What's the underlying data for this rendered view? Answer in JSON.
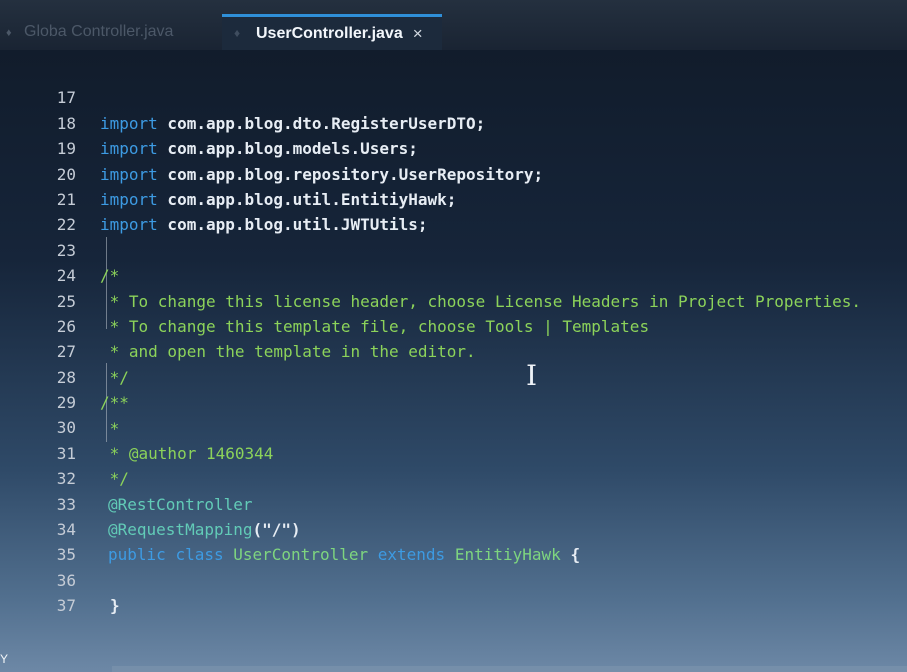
{
  "tabs": {
    "inactive_label": "Globa Controller.java",
    "active_label": "UserController.java",
    "close_glyph": "×"
  },
  "editor": {
    "lines": [
      {
        "num": "17",
        "kw": "import",
        "text": " com.app.blog.dto.RegisterUserDTO;"
      },
      {
        "num": "18",
        "kw": "import",
        "text": " com.app.blog.models.Users;"
      },
      {
        "num": "19",
        "kw": "import",
        "text": " com.app.blog.repository.UserRepository;"
      },
      {
        "num": "20",
        "kw": "import",
        "text": " com.app.blog.util.EntitiyHawk;"
      },
      {
        "num": "21",
        "kw": "import",
        "text": " com.app.blog.util.JWTUtils;"
      },
      {
        "num": "22"
      },
      {
        "num": "23",
        "comment": "/*"
      },
      {
        "num": "24",
        "comment": " * To change this license header, choose License Headers in Project Properties."
      },
      {
        "num": "25",
        "comment": " * To change this template file, choose Tools | Templates"
      },
      {
        "num": "26",
        "comment": " * and open the template in the editor."
      },
      {
        "num": "27",
        "comment": " */"
      },
      {
        "num": "28",
        "comment": "/**"
      },
      {
        "num": "29",
        "comment": " *"
      },
      {
        "num": "30",
        "comment": " * @author 1460344"
      },
      {
        "num": "31",
        "comment": " */"
      },
      {
        "num": "32",
        "annotation": "@RestController"
      },
      {
        "num": "33",
        "annotation": "@RequestMapping",
        "args": "(\"/\")"
      },
      {
        "num": "34",
        "decl": {
          "public": "public",
          "class": "class",
          "name": "UserController",
          "extends": "extends",
          "parent": "EntitiyHawk",
          "brace": "{"
        }
      },
      {
        "num": "35"
      },
      {
        "num": "36",
        "closing": "}"
      },
      {
        "num": "37"
      }
    ]
  },
  "colors": {
    "keyword": "#3d9be3",
    "comment": "#8cd35a",
    "annotation": "#62cbb7",
    "class_name": "#7ed57f",
    "tab_accent": "#2f8fd8"
  },
  "icons": {
    "inactive_tab_icon": "java-file-icon",
    "active_tab_icon": "pin-icon",
    "cursor_icon": "text-cursor-icon"
  },
  "footer": {
    "corner_mark": "Y"
  }
}
